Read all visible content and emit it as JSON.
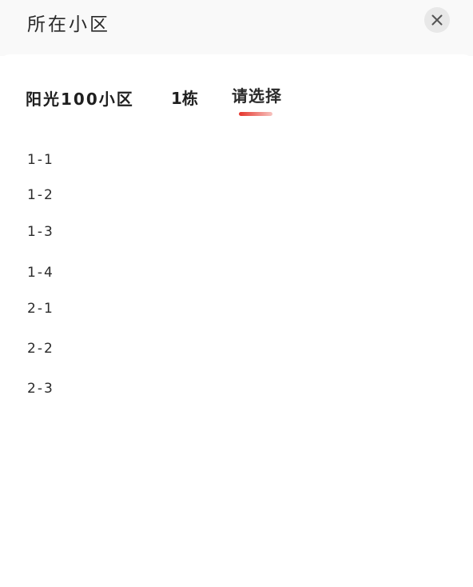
{
  "header": {
    "title": "所在小区",
    "close_icon": "close-icon"
  },
  "tabs": [
    {
      "label": "阳光100小区"
    },
    {
      "label": "1栋"
    },
    {
      "label": "请选择"
    }
  ],
  "accent_color": "#e5342b",
  "units": [
    {
      "label": "1-1"
    },
    {
      "label": "1-2"
    },
    {
      "label": "1-3"
    },
    {
      "label": "1-4"
    },
    {
      "label": "2-1"
    },
    {
      "label": "2-2"
    },
    {
      "label": "2-3"
    }
  ]
}
